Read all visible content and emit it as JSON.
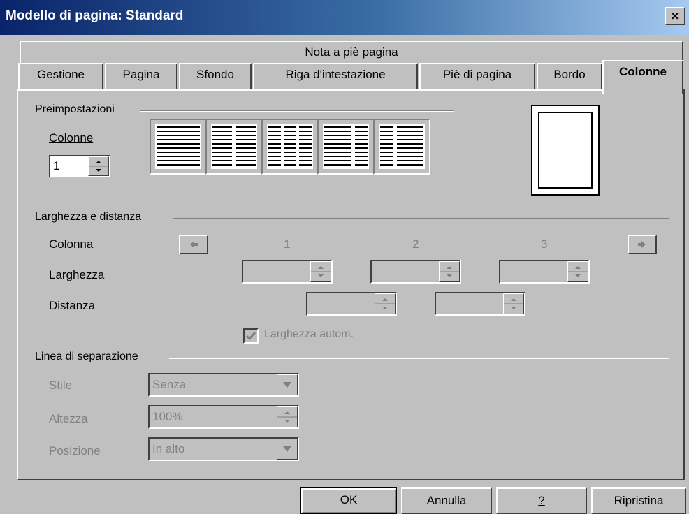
{
  "window": {
    "title": "Modello di pagina: Standard",
    "close_glyph": "×"
  },
  "tabs_row1": [
    "Nota a piè pagina"
  ],
  "tabs_row2": [
    "Gestione",
    "Pagina",
    "Sfondo",
    "Riga d'intestazione",
    "Piè di pagina",
    "Bordo",
    "Colonne"
  ],
  "active_tab": "Colonne",
  "presets": {
    "group_label": "Preimpostazioni",
    "columns_label": "Colonne",
    "columns_value": "1"
  },
  "width_spacing": {
    "group_label": "Larghezza e distanza",
    "column_label": "Colonna",
    "width_label": "Larghezza",
    "spacing_label": "Distanza",
    "column_numbers": [
      "1",
      "2",
      "3"
    ],
    "auto_width_label": "Larghezza autom.",
    "auto_width_checked": true
  },
  "separator": {
    "group_label": "Linea di separazione",
    "style_label": "Stile",
    "style_value": "Senza",
    "height_label": "Altezza",
    "height_value": "100%",
    "position_label": "Posizione",
    "position_value": "In alto"
  },
  "buttons": {
    "ok": "OK",
    "cancel": "Annulla",
    "help": "?",
    "reset": "Ripristina"
  },
  "icons": {
    "prev": "arrow-left-icon",
    "next": "arrow-right-icon",
    "spin": "spin-up-down-icon",
    "dropdown": "chevron-down-icon"
  }
}
